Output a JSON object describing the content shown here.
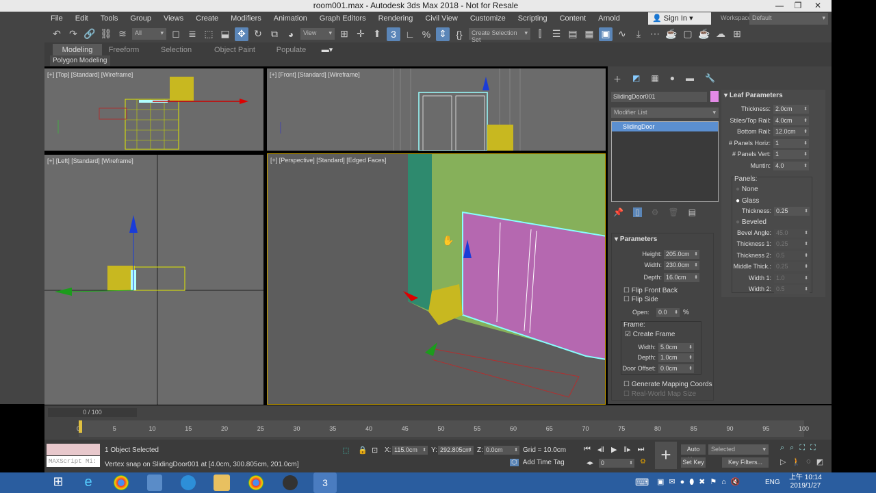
{
  "title": "room001.max - Autodesk 3ds Max 2018 - Not for Resale",
  "menu": [
    "File",
    "Edit",
    "Tools",
    "Group",
    "Views",
    "Create",
    "Modifiers",
    "Animation",
    "Graph Editors",
    "Rendering",
    "Civil View",
    "Customize",
    "Scripting",
    "Content",
    "Arnold"
  ],
  "signin": "Sign In",
  "workspaces_label": "Workspaces:",
  "workspaces_value": "Default",
  "toolbar": {
    "filter": "All",
    "refcoord": "View",
    "selset": "Create Selection Set"
  },
  "ribbon": {
    "tabs": [
      "Modeling",
      "Freeform",
      "Selection",
      "Object Paint",
      "Populate"
    ],
    "active": "Modeling",
    "panel": "Polygon Modeling"
  },
  "viewports": {
    "top": "[+] [Top] [Standard] [Wireframe]",
    "front": "[+] [Front] [Standard] [Wireframe]",
    "left": "[+] [Left] [Standard] [Wireframe]",
    "persp": "[+] [Perspective] [Standard] [Edged Faces]"
  },
  "cmd": {
    "object_name": "SlidingDoor001",
    "object_color": "#e38ae6",
    "modifier_list": "Modifier List",
    "stack": [
      "SlidingDoor"
    ],
    "params_title": "Parameters",
    "params": [
      {
        "label": "Height:",
        "value": "205.0cm"
      },
      {
        "label": "Width:",
        "value": "230.0cm"
      },
      {
        "label": "Depth:",
        "value": "16.0cm"
      }
    ],
    "flip_front": "Flip Front Back",
    "flip_side": "Flip Side",
    "open_label": "Open:",
    "open_value": "0.0",
    "open_unit": "%",
    "frame_group": "Frame:",
    "create_frame": "Create Frame",
    "frame": [
      {
        "label": "Width:",
        "value": "5.0cm"
      },
      {
        "label": "Depth:",
        "value": "1.0cm"
      },
      {
        "label": "Door Offset:",
        "value": "0.0cm"
      }
    ],
    "gen_mapping": "Generate Mapping Coords",
    "real_world": "Real-World Map Size",
    "leaf_title": "Leaf Parameters",
    "leaf": [
      {
        "label": "Thickness:",
        "value": "2.0cm"
      },
      {
        "label": "Stiles/Top Rail:",
        "value": "4.0cm"
      },
      {
        "label": "Bottom Rail:",
        "value": "12.0cm"
      },
      {
        "label": "# Panels Horiz:",
        "value": "1"
      },
      {
        "label": "# Panels Vert:",
        "value": "1"
      },
      {
        "label": "Muntin:",
        "value": "4.0"
      }
    ],
    "panels_group": "Panels:",
    "panel_none": "None",
    "panel_glass": "Glass",
    "glass_thick_label": "Thickness:",
    "glass_thick": "0.25",
    "panel_beveled": "Beveled",
    "bevel": [
      {
        "label": "Bevel Angle:",
        "value": "45.0"
      },
      {
        "label": "Thickness 1:",
        "value": "0.25"
      },
      {
        "label": "Thickness 2:",
        "value": "0.5"
      },
      {
        "label": "Middle Thick.:",
        "value": "0.25"
      },
      {
        "label": "Width 1:",
        "value": "1.0"
      },
      {
        "label": "Width 2:",
        "value": "0.5"
      }
    ]
  },
  "timeline": {
    "frame": "0 / 100",
    "ticks": [
      "0",
      "5",
      "10",
      "15",
      "20",
      "25",
      "30",
      "35",
      "40",
      "45",
      "50",
      "55",
      "60",
      "65",
      "70",
      "75",
      "80",
      "85",
      "90",
      "95",
      "100"
    ]
  },
  "status": {
    "maxscript": "MAXScript Mi:",
    "selected": "1 Object Selected",
    "prompt": "Vertex snap on SlidingDoor001 at [4.0cm, 300.805cm, 201.0cm]",
    "x": "115.0cm",
    "y": "292.805cm",
    "z": "0.0cm",
    "grid": "Grid = 10.0cm",
    "add_time_tag": "Add Time Tag",
    "frame_field": "0",
    "auto_key": "Auto Key",
    "set_key": "Set Key",
    "key_mode": "Selected",
    "key_filters": "Key Filters..."
  },
  "taskbar": {
    "lang": "ENG",
    "time": "上午 10:14",
    "date": "2019/1/27"
  }
}
